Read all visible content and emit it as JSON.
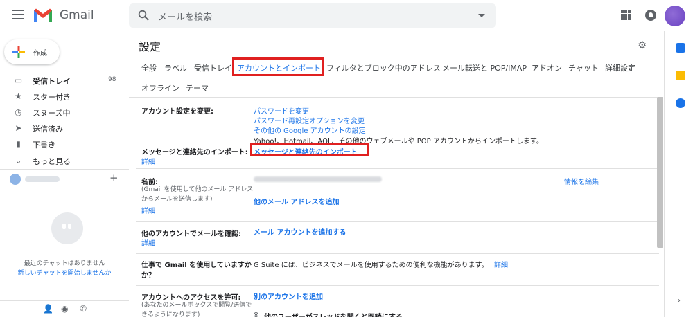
{
  "app": {
    "brand": "Gmail"
  },
  "search": {
    "placeholder": "メールを検索"
  },
  "compose": {
    "label": "作成"
  },
  "sidebar": {
    "items": [
      {
        "label": "受信トレイ",
        "count": "98",
        "icon": "inbox-icon"
      },
      {
        "label": "スター付き",
        "icon": "star-icon"
      },
      {
        "label": "スヌーズ中",
        "icon": "clock-icon"
      },
      {
        "label": "送信済み",
        "icon": "send-icon"
      },
      {
        "label": "下書き",
        "icon": "draft-icon"
      },
      {
        "label": "もっと見る",
        "icon": "chevron-down-icon"
      }
    ]
  },
  "hangouts": {
    "no_chats": "最近のチャットはありません",
    "start_new": "新しいチャットを開始しませんか"
  },
  "settings": {
    "title": "設定",
    "tabs": [
      "全般",
      "ラベル",
      "受信トレイ",
      "アカウントとインポート",
      "フィルタとブロック中のアドレス",
      "メール転送と POP/IMAP",
      "アドオン",
      "チャット",
      "詳細設定",
      "オフライン",
      "テーマ"
    ],
    "active_tab": "アカウントとインポート",
    "change_account": {
      "label": "アカウント設定を変更:",
      "links": [
        "パスワードを変更",
        "パスワード再設定オプションを変更",
        "その他の Google アカウントの設定"
      ]
    },
    "import": {
      "desc": "Yahoo!、Hotmail、AOL、その他のウェブメールや POP アカウントからインポートします。",
      "label": "メッセージと連絡先のインポート:",
      "detail": "詳細",
      "link": "メッセージと連絡先のインポート"
    },
    "name": {
      "label": "名前:",
      "sub": [
        "(Gmail を使用して他のメール アドレス",
        "からメールを送信します)"
      ],
      "detail": "詳細",
      "edit": "情報を編集",
      "add": "他のメール アドレスを追加"
    },
    "check_mail": {
      "label": "他のアカウントでメールを確認:",
      "detail": "詳細",
      "add": "メール アカウントを追加する"
    },
    "gsuite": {
      "label": [
        "仕事で Gmail を使用していますか",
        "か？"
      ],
      "text": "G Suite には、ビジネスでメールを使用するための便利な機能があります。",
      "detail": "詳細"
    },
    "access": {
      "label": "アカウントへのアクセスを許可:",
      "sub": [
        "(あなたのメールボックスで閲覧/送信で",
        "きるようになります)"
      ],
      "add": "別のアカウントを追加",
      "option": "他のユーザーがスレッドを開くと既読にする"
    }
  },
  "colors": {
    "accent": "#1a73e8",
    "highlight": "#e02020"
  }
}
